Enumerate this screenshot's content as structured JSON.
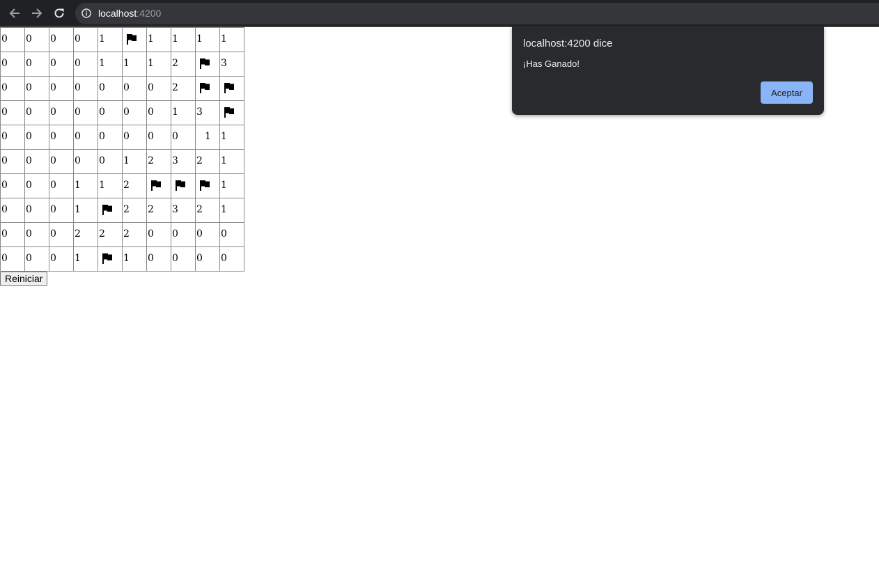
{
  "browser": {
    "url_host": "localhost",
    "url_port": ":4200",
    "colors": {
      "toolbar_bg": "#202124",
      "omnibox_bg": "#35363a"
    },
    "icons": [
      "back-arrow-icon",
      "forward-arrow-icon",
      "reload-icon",
      "info-icon"
    ]
  },
  "board": {
    "rows": [
      [
        "0",
        "0",
        "0",
        "0",
        "1",
        "F",
        "1",
        "1",
        "1",
        "1"
      ],
      [
        "0",
        "0",
        "0",
        "0",
        "1",
        "1",
        "1",
        "2",
        "F",
        "3"
      ],
      [
        "0",
        "0",
        "0",
        "0",
        "0",
        "0",
        "0",
        "2",
        "F",
        "F"
      ],
      [
        "0",
        "0",
        "0",
        "0",
        "0",
        "0",
        "0",
        "1",
        "3",
        "F"
      ],
      [
        "0",
        "0",
        "0",
        "0",
        "0",
        "0",
        "0",
        "0",
        "1",
        "1"
      ],
      [
        "0",
        "0",
        "0",
        "0",
        "0",
        "1",
        "2",
        "3",
        "2",
        "1"
      ],
      [
        "0",
        "0",
        "0",
        "1",
        "1",
        "2",
        "F",
        "F",
        "F",
        "1"
      ],
      [
        "0",
        "0",
        "0",
        "1",
        "F",
        "2",
        "2",
        "3",
        "2",
        "1"
      ],
      [
        "0",
        "0",
        "0",
        "2",
        "2",
        "2",
        "0",
        "0",
        "0",
        "0"
      ],
      [
        "0",
        "0",
        "0",
        "1",
        "F",
        "1",
        "0",
        "0",
        "0",
        "0"
      ]
    ],
    "flag_icon": "flag-icon",
    "restart_label": "Reiniciar"
  },
  "dialog": {
    "title": "localhost:4200 dice",
    "message": "¡Has Ganado!",
    "ok_label": "Aceptar",
    "accent": "#8ab4f8"
  }
}
